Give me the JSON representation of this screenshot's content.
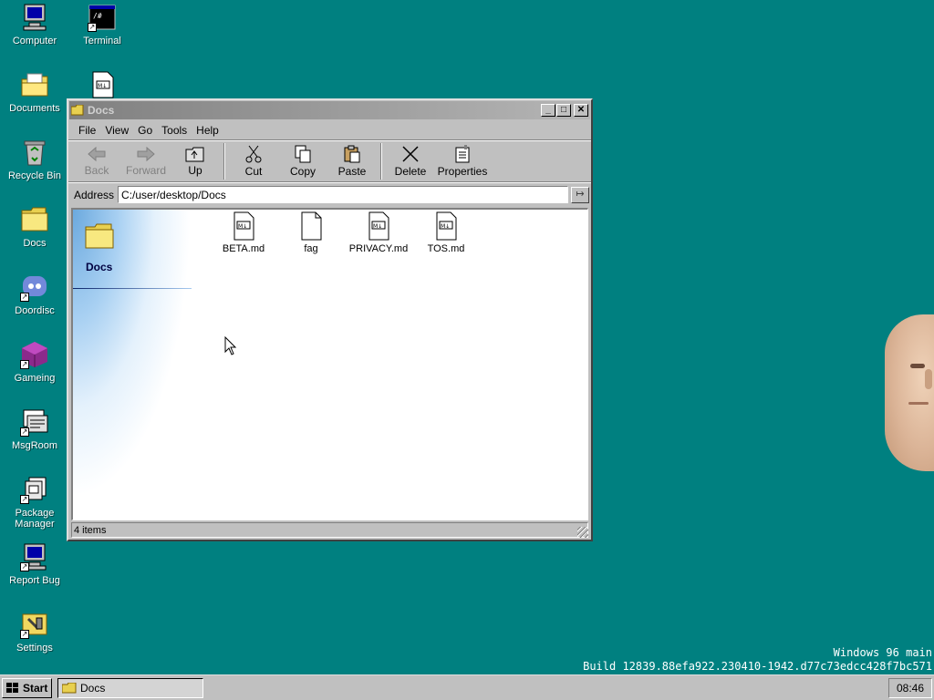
{
  "desktop": {
    "icons": [
      {
        "label": "Computer",
        "icon": "computer-icon"
      },
      {
        "label": "Terminal",
        "icon": "terminal-icon"
      },
      {
        "label": "Documents",
        "icon": "documents-folder-icon"
      },
      {
        "label": "Recycle Bin",
        "icon": "recycle-bin-icon"
      },
      {
        "label": "Docs",
        "icon": "folder-icon"
      },
      {
        "label": "Doordisc",
        "icon": "doordisc-icon"
      },
      {
        "label": "Gameing",
        "icon": "gameing-icon"
      },
      {
        "label": "MsgRoom",
        "icon": "msgroom-icon"
      },
      {
        "label": "Package Manager",
        "icon": "package-manager-icon"
      },
      {
        "label": "Report Bug",
        "icon": "report-bug-icon"
      },
      {
        "label": "Settings",
        "icon": "settings-icon"
      }
    ],
    "partial_icon": "markdown-file-icon",
    "build": {
      "line1": "Windows 96 main",
      "line2": "Build 12839.88efa922.230410-1942.d77c73edcc428f7bc571"
    }
  },
  "window": {
    "title": "Docs",
    "buttons": {
      "minimize": "_",
      "maximize": "□",
      "close": "✕"
    },
    "menu": [
      "File",
      "View",
      "Go",
      "Tools",
      "Help"
    ],
    "toolbar": {
      "back": "Back",
      "forward": "Forward",
      "up": "Up",
      "cut": "Cut",
      "copy": "Copy",
      "paste": "Paste",
      "delete": "Delete",
      "properties": "Properties"
    },
    "address": {
      "label": "Address",
      "value": "C:/user/desktop/Docs",
      "go": "↦"
    },
    "side_panel_title": "Docs",
    "files": [
      {
        "name": "BETA.md",
        "type": "markdown"
      },
      {
        "name": "fag",
        "type": "blank"
      },
      {
        "name": "PRIVACY.md",
        "type": "markdown"
      },
      {
        "name": "TOS.md",
        "type": "markdown"
      }
    ],
    "status": "4 items"
  },
  "taskbar": {
    "start_label": "Start",
    "items": [
      {
        "label": "Docs"
      }
    ],
    "clock": "08:46"
  }
}
